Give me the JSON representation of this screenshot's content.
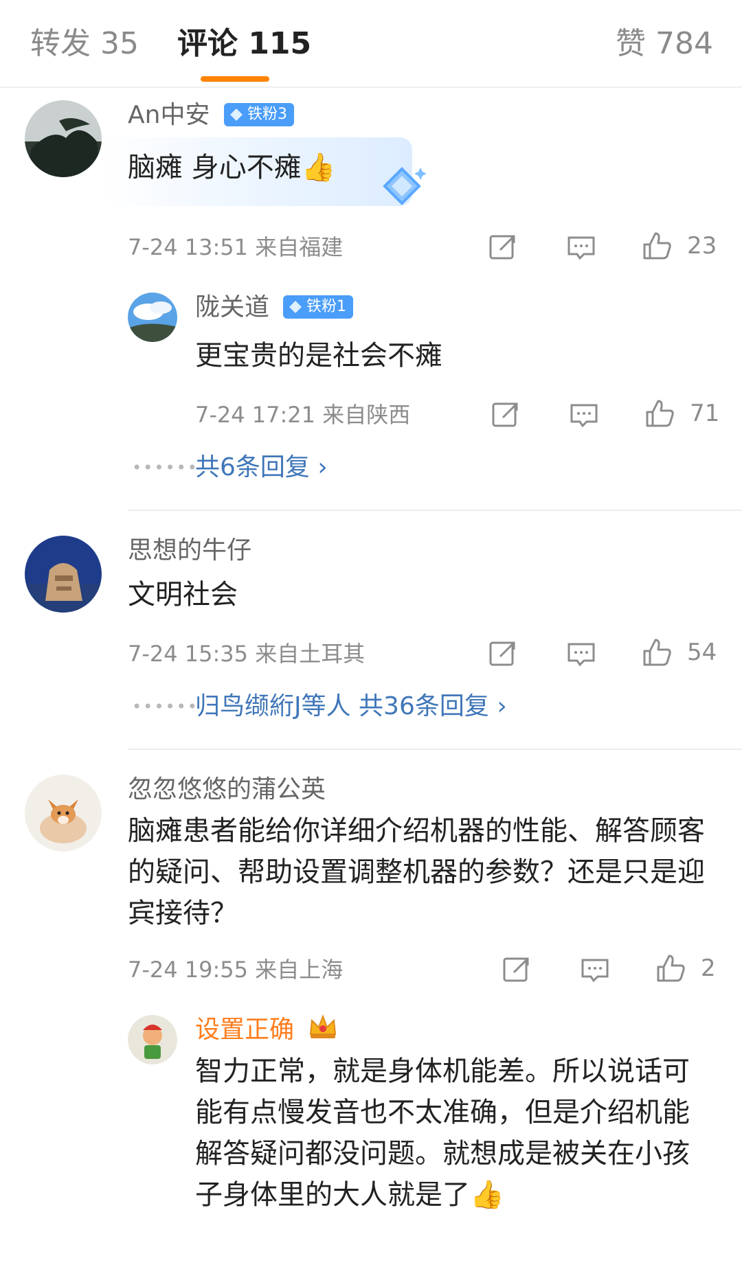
{
  "tabs": {
    "repost": "转发 35",
    "comments": "评论 115",
    "likes": "赞 784"
  },
  "icons": {
    "share": "share-icon",
    "reply": "comment-icon",
    "like": "thumbs-up-icon"
  },
  "colors": {
    "accent": "#ff8200",
    "link": "#3f76b8",
    "badge": "#4a9df8",
    "vip_name": "#ff7d1d"
  },
  "comments": [
    {
      "user": "An中安",
      "badge": "铁粉3",
      "text": "脑瘫 身心不瘫👍",
      "meta": "7-24 13:51  来自福建",
      "likes": "23",
      "reply": {
        "user": "陇关道",
        "badge": "铁粉1",
        "text": "更宝贵的是社会不瘫",
        "meta": "7-24 17:21  来自陕西",
        "likes": "71"
      },
      "more": "共6条回复 ›"
    },
    {
      "user": "思想的牛仔",
      "text": "文明社会",
      "meta": "7-24 15:35  来自土耳其",
      "likes": "54",
      "more": "归鸟缬絎J等人  共36条回复 ›"
    },
    {
      "user": "忽忽悠悠的蒲公英",
      "text": "脑瘫患者能给你详细介绍机器的性能、解答顾客的疑问、帮助设置调整机器的参数？还是只是迎宾接待？",
      "meta": "7-24 19:55  来自上海",
      "likes": "2",
      "reply": {
        "user": "设置正确",
        "text": "智力正常，就是身体机能差。所以说话可能有点慢发音也不太准确，但是介绍机能解答疑问都没问题。就想成是被关在小孩子身体里的大人就是了👍"
      }
    }
  ]
}
